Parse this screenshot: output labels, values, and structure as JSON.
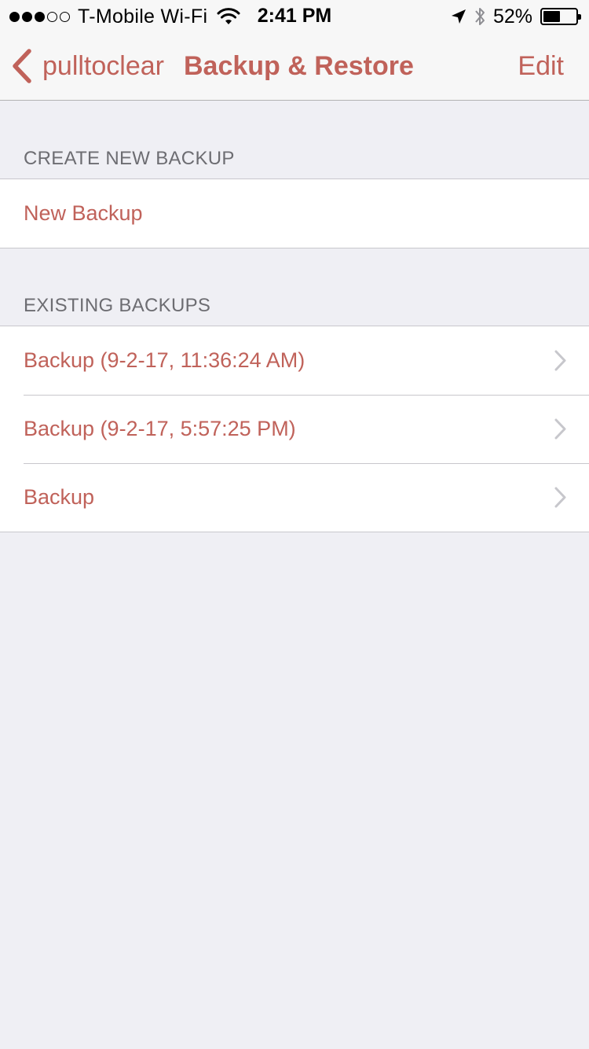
{
  "status_bar": {
    "carrier": "T-Mobile Wi-Fi",
    "time": "2:41 PM",
    "battery_percent": "52%",
    "battery_level": 0.52,
    "signal_bars_filled": 3,
    "signal_bars_total": 5
  },
  "nav": {
    "back_label": "pulltoclear",
    "title": "Backup & Restore",
    "edit_label": "Edit"
  },
  "sections": {
    "create": {
      "header": "CREATE NEW BACKUP",
      "new_backup_label": "New Backup"
    },
    "existing": {
      "header": "EXISTING BACKUPS",
      "items": [
        {
          "label": "Backup (9-2-17, 11:36:24 AM)"
        },
        {
          "label": "Backup (9-2-17, 5:57:25 PM)"
        },
        {
          "label": "Backup"
        }
      ]
    }
  },
  "colors": {
    "accent": "#c0625a",
    "background": "#efeff4",
    "header_text": "#6d6d72"
  }
}
